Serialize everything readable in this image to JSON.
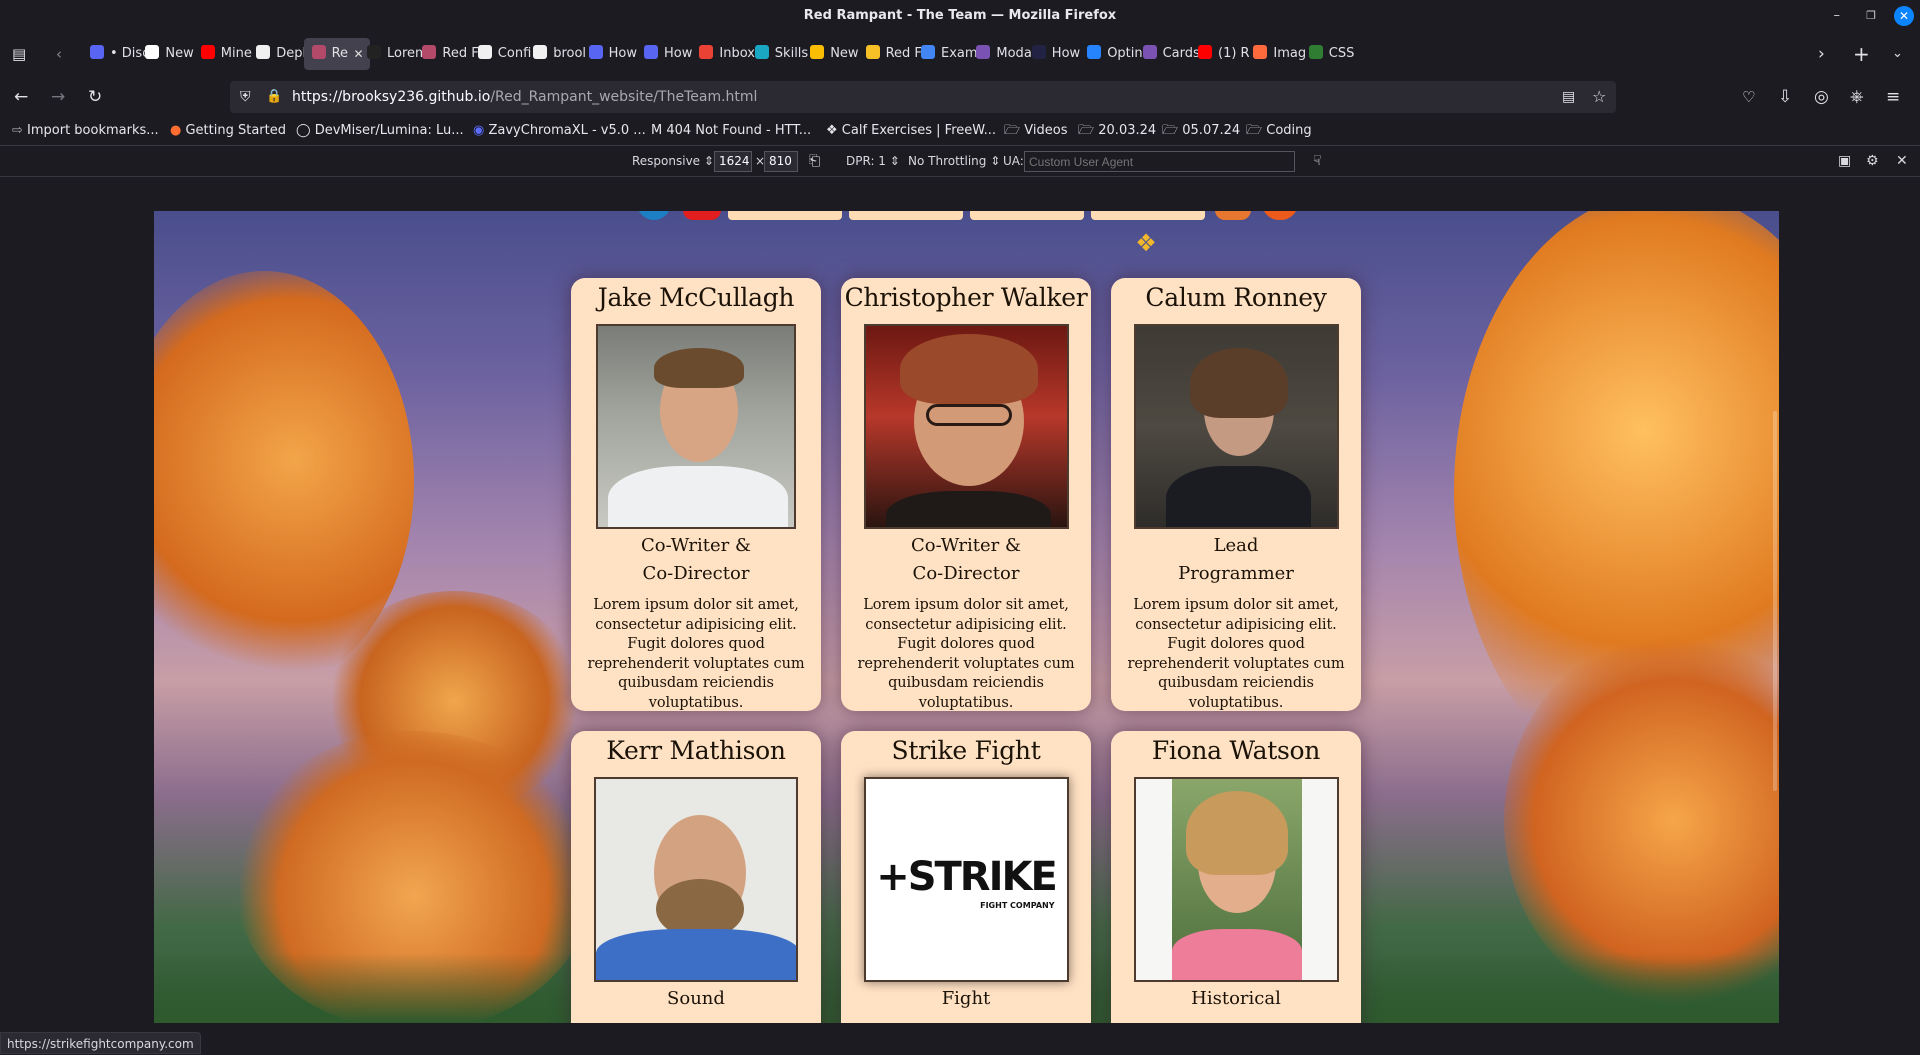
{
  "window": {
    "title": "Red Rampant - The Team — Mozilla Firefox"
  },
  "tabs": [
    {
      "label": "• Disc",
      "color": "#5865f2"
    },
    {
      "label": "New",
      "color": "#ffffff"
    },
    {
      "label": "Mine",
      "color": "#ff0000"
    },
    {
      "label": "Depl",
      "color": "#f0f0f0"
    },
    {
      "label": "Re",
      "color": "#b44a6a",
      "active": true
    },
    {
      "label": "Lorem",
      "color": "#222222"
    },
    {
      "label": "Red F",
      "color": "#b44a6a"
    },
    {
      "label": "Confi",
      "color": "#f0f0f0"
    },
    {
      "label": "brool",
      "color": "#f0f0f0"
    },
    {
      "label": "How",
      "color": "#5865f2"
    },
    {
      "label": "How",
      "color": "#5865f2"
    },
    {
      "label": "Inbox",
      "color": "#ea4335"
    },
    {
      "label": "Skills",
      "color": "#1aa7c4"
    },
    {
      "label": "New",
      "color": "#fbbc04"
    },
    {
      "label": "Red F",
      "color": "#f6c026"
    },
    {
      "label": "Exam",
      "color": "#4285f4"
    },
    {
      "label": "Moda",
      "color": "#7952b3"
    },
    {
      "label": "How",
      "color": "#222244"
    },
    {
      "label": "Optin",
      "color": "#2684ff"
    },
    {
      "label": "Cards",
      "color": "#7952b3"
    },
    {
      "label": "(1) R",
      "color": "#ff0000"
    },
    {
      "label": "Imag",
      "color": "#ff6a3d"
    },
    {
      "label": "CSS",
      "color": "#2e7d32"
    }
  ],
  "toolbar": {
    "url_host": "https://brooksy236.github.io",
    "url_path": "/Red_Rampant_website/TheTeam.html"
  },
  "bookmarks": [
    "Import bookmarks...",
    "Getting Started",
    "DevMiser/Lumina: Lu...",
    "ZavyChromaXL - v5.0 ...",
    "404 Not Found - HTT...",
    "Calf Exercises | FreeW...",
    "Videos",
    "20.03.24",
    "05.07.24",
    "Coding"
  ],
  "responsive": {
    "mode": "Responsive",
    "width": "1624",
    "height": "810",
    "times": "×",
    "dpr": "DPR: 1",
    "throttling": "No Throttling",
    "ua_label": "UA:",
    "ua_placeholder": "Custom User Agent"
  },
  "team": [
    {
      "name": "Jake McCullagh",
      "role_line1": "Co-Writer &",
      "role_line2": "Co-Director",
      "bio": "Lorem ipsum dolor sit amet, consectetur adipisicing elit. Fugit dolores quod reprehenderit voluptates cum quibusdam reiciendis voluptatibus."
    },
    {
      "name": "Christopher Walker",
      "role_line1": "Co-Writer &",
      "role_line2": "Co-Director",
      "bio": "Lorem ipsum dolor sit amet, consectetur adipisicing elit. Fugit dolores quod reprehenderit voluptates cum quibusdam reiciendis voluptatibus."
    },
    {
      "name": "Calum Ronney",
      "role_line1": "Lead",
      "role_line2": "Programmer",
      "bio": "Lorem ipsum dolor sit amet, consectetur adipisicing elit. Fugit dolores quod reprehenderit voluptates cum quibusdam reiciendis voluptatibus."
    },
    {
      "name": "Kerr Mathison",
      "role_line1": "Sound",
      "role_line2": "",
      "bio": ""
    },
    {
      "name": "Strike Fight",
      "role_line1": "Fight",
      "role_line2": "",
      "bio": "",
      "logo_text": "+STRIKE",
      "logo_sub": "FIGHT COMPANY"
    },
    {
      "name": "Fiona Watson",
      "role_line1": "Historical",
      "role_line2": "",
      "bio": ""
    }
  ],
  "statusbar": {
    "text": "https://strikefightcompany.com"
  }
}
